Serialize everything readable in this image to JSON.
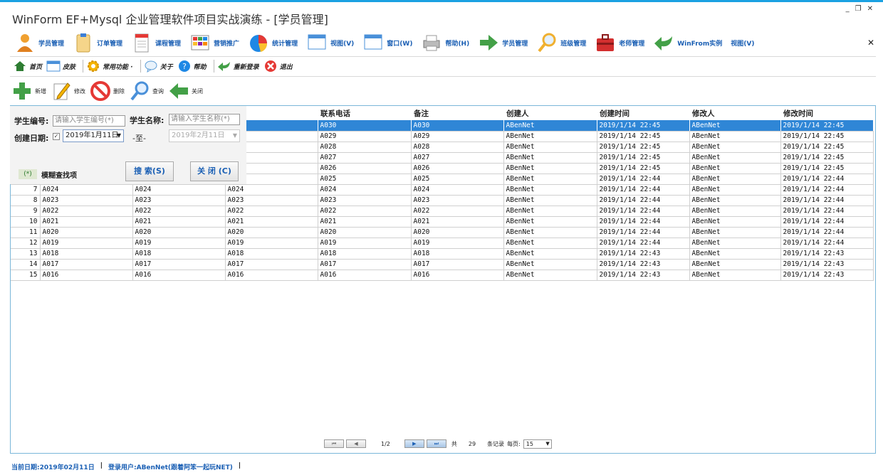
{
  "window": {
    "title": "WinForm EF+Mysql 企业管理软件项目实战演练 - [学员管理]",
    "min_glyph": "_",
    "restore_glyph": "❐",
    "close_glyph": "✕",
    "menu_close_glyph": "✕"
  },
  "menu": [
    {
      "label": "学员管理",
      "icon": "user-icon"
    },
    {
      "label": "订单管理",
      "icon": "clipboard-icon"
    },
    {
      "label": "课程管理",
      "icon": "document-icon"
    },
    {
      "label": "营销推广",
      "icon": "grid-icon"
    },
    {
      "label": "统计管理",
      "icon": "pie-chart-icon"
    },
    {
      "label": "视图(V)",
      "icon": "window-icon"
    },
    {
      "label": "窗口(W)",
      "icon": "window-icon"
    },
    {
      "label": "帮助(H)",
      "icon": "printer-icon"
    },
    {
      "label": "学员管理",
      "icon": "arrow-right-icon"
    },
    {
      "label": "班级管理",
      "icon": "magnifier-icon"
    },
    {
      "label": "老师管理",
      "icon": "toolbox-icon"
    },
    {
      "label": "WinFrom实例",
      "icon": "arrow-back-icon"
    },
    {
      "label": "视图(V)",
      "icon": ""
    }
  ],
  "toolbar2": [
    {
      "label": "首页",
      "icon": "home-icon"
    },
    {
      "label": "皮肤",
      "icon": "window-icon"
    },
    {
      "label": "常用功能 ·",
      "icon": "gear-icon"
    },
    {
      "label": "关于",
      "icon": "chat-icon"
    },
    {
      "label": "帮助",
      "icon": "help-icon"
    },
    {
      "label": "重新登录",
      "icon": "check-arrow-icon"
    },
    {
      "label": "退出",
      "icon": "exit-icon"
    }
  ],
  "toolbar3": [
    {
      "label": "新增",
      "icon": "plus-icon"
    },
    {
      "label": "修改",
      "icon": "edit-icon"
    },
    {
      "label": "删除",
      "icon": "no-entry-icon"
    },
    {
      "label": "查询",
      "icon": "magnifier-icon"
    },
    {
      "label": "关闭",
      "icon": "arrow-back-icon"
    }
  ],
  "search": {
    "code_label": "学生编号:",
    "code_placeholder": "请输入学生编号(*)",
    "name_label": "学生名称:",
    "name_placeholder": "请输入学生名称(*)",
    "date_label": "创建日期:",
    "date_checked": "✓",
    "date_from": "2019年1月11日",
    "date_sep": "-至-",
    "date_to": "2019年2月11日",
    "search_btn": "搜 索(S)",
    "close_btn": "关 闭 (C)",
    "fuzzy_mark": "(*)",
    "fuzzy_label": "模糊查找项",
    "dropdown_glyph": "▼"
  },
  "grid": {
    "columns": [
      "",
      "",
      "",
      "",
      "联系电话",
      "备注",
      "创建人",
      "创建时间",
      "修改人",
      "修改时间"
    ],
    "rows": [
      {
        "n": "",
        "c1": "",
        "c2": "",
        "c3": "",
        "phone": "A030",
        "note": "A030",
        "creator": "ABenNet",
        "created": "2019/1/14 22:45",
        "modifier": "ABenNet",
        "modified": "2019/1/14 22:45"
      },
      {
        "n": "",
        "c1": "",
        "c2": "",
        "c3": "",
        "phone": "A029",
        "note": "A029",
        "creator": "ABenNet",
        "created": "2019/1/14 22:45",
        "modifier": "ABenNet",
        "modified": "2019/1/14 22:45"
      },
      {
        "n": "",
        "c1": "",
        "c2": "",
        "c3": "",
        "phone": "A028",
        "note": "A028",
        "creator": "ABenNet",
        "created": "2019/1/14 22:45",
        "modifier": "ABenNet",
        "modified": "2019/1/14 22:45"
      },
      {
        "n": "",
        "c1": "",
        "c2": "",
        "c3": "",
        "phone": "A027",
        "note": "A027",
        "creator": "ABenNet",
        "created": "2019/1/14 22:45",
        "modifier": "ABenNet",
        "modified": "2019/1/14 22:45"
      },
      {
        "n": "",
        "c1": "",
        "c2": "",
        "c3": "",
        "phone": "A026",
        "note": "A026",
        "creator": "ABenNet",
        "created": "2019/1/14 22:45",
        "modifier": "ABenNet",
        "modified": "2019/1/14 22:45"
      },
      {
        "n": "",
        "c1": "",
        "c2": "",
        "c3": "",
        "phone": "A025",
        "note": "A025",
        "creator": "ABenNet",
        "created": "2019/1/14 22:44",
        "modifier": "ABenNet",
        "modified": "2019/1/14 22:44"
      },
      {
        "n": "7",
        "c1": "A024",
        "c2": "A024",
        "c3": "A024",
        "phone": "A024",
        "note": "A024",
        "creator": "ABenNet",
        "created": "2019/1/14 22:44",
        "modifier": "ABenNet",
        "modified": "2019/1/14 22:44"
      },
      {
        "n": "8",
        "c1": "A023",
        "c2": "A023",
        "c3": "A023",
        "phone": "A023",
        "note": "A023",
        "creator": "ABenNet",
        "created": "2019/1/14 22:44",
        "modifier": "ABenNet",
        "modified": "2019/1/14 22:44"
      },
      {
        "n": "9",
        "c1": "A022",
        "c2": "A022",
        "c3": "A022",
        "phone": "A022",
        "note": "A022",
        "creator": "ABenNet",
        "created": "2019/1/14 22:44",
        "modifier": "ABenNet",
        "modified": "2019/1/14 22:44"
      },
      {
        "n": "10",
        "c1": "A021",
        "c2": "A021",
        "c3": "A021",
        "phone": "A021",
        "note": "A021",
        "creator": "ABenNet",
        "created": "2019/1/14 22:44",
        "modifier": "ABenNet",
        "modified": "2019/1/14 22:44"
      },
      {
        "n": "11",
        "c1": "A020",
        "c2": "A020",
        "c3": "A020",
        "phone": "A020",
        "note": "A020",
        "creator": "ABenNet",
        "created": "2019/1/14 22:44",
        "modifier": "ABenNet",
        "modified": "2019/1/14 22:44"
      },
      {
        "n": "12",
        "c1": "A019",
        "c2": "A019",
        "c3": "A019",
        "phone": "A019",
        "note": "A019",
        "creator": "ABenNet",
        "created": "2019/1/14 22:44",
        "modifier": "ABenNet",
        "modified": "2019/1/14 22:44"
      },
      {
        "n": "13",
        "c1": "A018",
        "c2": "A018",
        "c3": "A018",
        "phone": "A018",
        "note": "A018",
        "creator": "ABenNet",
        "created": "2019/1/14 22:43",
        "modifier": "ABenNet",
        "modified": "2019/1/14 22:43"
      },
      {
        "n": "14",
        "c1": "A017",
        "c2": "A017",
        "c3": "A017",
        "phone": "A017",
        "note": "A017",
        "creator": "ABenNet",
        "created": "2019/1/14 22:43",
        "modifier": "ABenNet",
        "modified": "2019/1/14 22:43"
      },
      {
        "n": "15",
        "c1": "A016",
        "c2": "A016",
        "c3": "A016",
        "phone": "A016",
        "note": "A016",
        "creator": "ABenNet",
        "created": "2019/1/14 22:43",
        "modifier": "ABenNet",
        "modified": "2019/1/14 22:43"
      }
    ]
  },
  "pager": {
    "first": "⏮",
    "prev": "◀",
    "page_text": "1/2",
    "next": "▶",
    "last": "⏭",
    "total_prefix": "共",
    "total": "29",
    "total_suffix": "条记录",
    "per_page_label": "每页:",
    "per_page": "15"
  },
  "status": {
    "date": "当前日期:2019年02月11日",
    "sep": "|",
    "user": "登录用户:ABenNet(跟着阿笨一起玩NET)",
    "sep2": "|"
  },
  "colors": {
    "accent": "#1ba1e2",
    "selected_row": "#2f86d6",
    "link": "#1a5fb4"
  }
}
